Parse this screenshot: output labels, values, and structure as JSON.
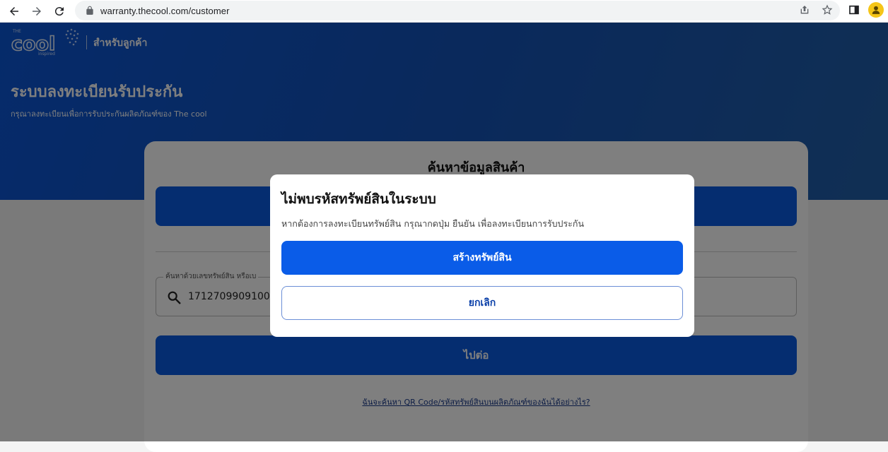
{
  "browser": {
    "url": "warranty.thecool.com/customer",
    "back_icon": "arrow-left-icon",
    "forward_icon": "arrow-right-icon",
    "reload_icon": "reload-icon"
  },
  "header": {
    "logo_text": "cool",
    "logo_top": "THE",
    "logo_bottom": "inspired",
    "for_customer": "สำหรับลูกค้า"
  },
  "hero": {
    "title": "ระบบลงทะเบียนรับประกัน",
    "subtitle": "กรุณาลงทะเบียนเพื่อการรับประกันผลิตภัณฑ์ของ The cool"
  },
  "card": {
    "title": "ค้นหาข้อมูลสินค้า",
    "search_legend": "ค้นหาด้วยเลขทรัพย์สิน หรือเบ",
    "search_value": "1712709909100",
    "continue_label": "ไปต่อ",
    "help_link": "ฉันจะค้นหา QR Code/รหัสทรัพย์สินบนผลิตภัณฑ์ของฉันได้อย่างไร?"
  },
  "modal": {
    "title": "ไม่พบรหัสทรัพย์สินในระบบ",
    "description": "หากต้องการลงทะเบียนทรัพย์สิน กรุณากดปุ่ม ยืนยัน เพื่อลงทะเบียนการรับประกัน",
    "primary_label": "สร้างทรัพย์สิน",
    "secondary_label": "ยกเลิก"
  },
  "colors": {
    "primary": "#0a5ce8",
    "hero": "#0b56d6"
  }
}
